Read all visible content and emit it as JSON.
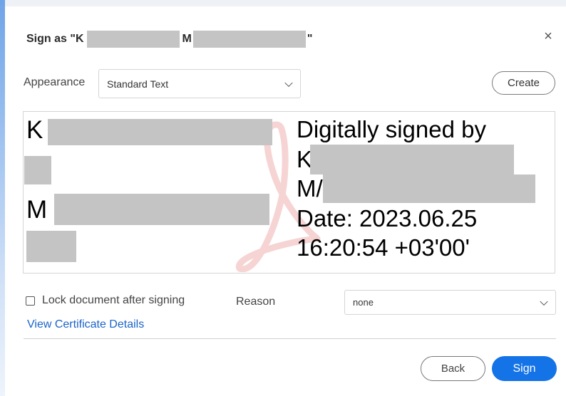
{
  "dialog": {
    "title_prefix": "Sign as \"K",
    "title_middle": "M",
    "title_suffix": "\"",
    "close_symbol": "×"
  },
  "appearance": {
    "label": "Appearance",
    "selected": "Standard Text",
    "create_label": "Create"
  },
  "preview": {
    "name_line1_initial": "K",
    "name_line2_initial": "M",
    "signed_by": "Digitally signed by",
    "signer_line1_initial": "K",
    "signer_line2_initial": "M/",
    "date": "Date: 2023.06.25",
    "time": "16:20:54 +03'00'"
  },
  "options": {
    "lock_label": "Lock document after signing",
    "lock_checked": false,
    "reason_label": "Reason",
    "reason_selected": "none",
    "view_certificate": "View Certificate Details"
  },
  "footer": {
    "back_label": "Back",
    "sign_label": "Sign"
  },
  "colors": {
    "accent": "#1473e6",
    "link": "#1a63c9",
    "redaction": "#c4c4c4"
  },
  "icons": [
    "close-icon",
    "chevron-down-icon",
    "checkbox-icon",
    "acrobat-watermark-icon"
  ]
}
